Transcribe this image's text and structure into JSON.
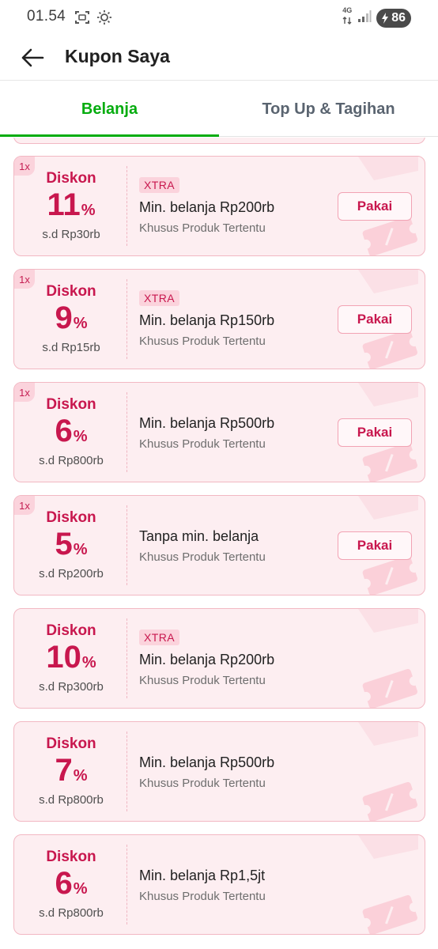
{
  "status_bar": {
    "time": "01.54",
    "network": "4G",
    "battery": "86"
  },
  "header": {
    "title": "Kupon Saya"
  },
  "tabs": [
    {
      "label": "Belanja",
      "active": true
    },
    {
      "label": "Top Up & Tagihan",
      "active": false
    }
  ],
  "colors": {
    "accent_green": "#03ac0e",
    "coupon_red": "#c8174e",
    "coupon_bg": "#fdeef1",
    "coupon_border": "#f2b8c3"
  },
  "coupons": [
    {
      "qty": "1x",
      "label": "Diskon",
      "value": "11",
      "unit": "%",
      "cap": "s.d Rp30rb",
      "tag": "XTRA",
      "min": "Min. belanja Rp200rb",
      "scope": "Khusus Produk Tertentu",
      "button": "Pakai"
    },
    {
      "qty": "1x",
      "label": "Diskon",
      "value": "9",
      "unit": "%",
      "cap": "s.d Rp15rb",
      "tag": "XTRA",
      "min": "Min. belanja Rp150rb",
      "scope": "Khusus Produk Tertentu",
      "button": "Pakai"
    },
    {
      "qty": "1x",
      "label": "Diskon",
      "value": "6",
      "unit": "%",
      "cap": "s.d Rp800rb",
      "min": "Min. belanja Rp500rb",
      "scope": "Khusus Produk Tertentu",
      "button": "Pakai"
    },
    {
      "qty": "1x",
      "label": "Diskon",
      "value": "5",
      "unit": "%",
      "cap": "s.d Rp200rb",
      "min": "Tanpa min. belanja",
      "scope": "Khusus Produk Tertentu",
      "button": "Pakai"
    },
    {
      "label": "Diskon",
      "value": "10",
      "unit": "%",
      "cap": "s.d Rp300rb",
      "tag": "XTRA",
      "min": "Min. belanja Rp200rb",
      "scope": "Khusus Produk Tertentu"
    },
    {
      "label": "Diskon",
      "value": "7",
      "unit": "%",
      "cap": "s.d Rp800rb",
      "min": "Min. belanja Rp500rb",
      "scope": "Khusus Produk Tertentu"
    },
    {
      "label": "Diskon",
      "value": "6",
      "unit": "%",
      "cap": "s.d Rp800rb",
      "min": "Min. belanja Rp1,5jt",
      "scope": "Khusus Produk Tertentu"
    }
  ]
}
